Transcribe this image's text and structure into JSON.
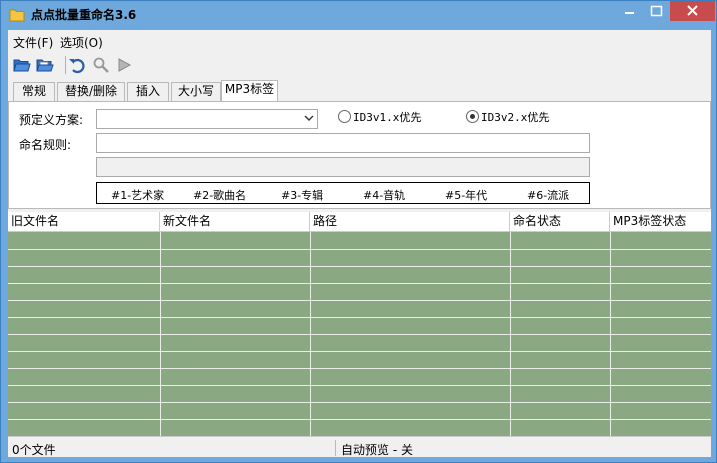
{
  "window": {
    "title": "点点批量重命名3.6",
    "icon": "folder-icon",
    "colors": {
      "frame": "#6ea8dc",
      "close": "#c94c4c",
      "grid": "#8aa982"
    }
  },
  "menu": {
    "file": "文件(F)",
    "options": "选项(O)"
  },
  "toolbar": {
    "icons": [
      "open-folder-icon",
      "open-files-icon",
      "undo-icon",
      "search-icon",
      "play-icon"
    ]
  },
  "tabs": [
    "常规",
    "替换/删除",
    "插入",
    "大小写",
    "MP3标签"
  ],
  "mp3": {
    "preset_label": "预定义方案:",
    "preset_value": "",
    "radio1": "ID3v1.x优先",
    "radio2": "ID3v2.x优先",
    "rule_label": "命名规则:",
    "rule_value": "",
    "preview_value": "",
    "tags": [
      "#1-艺术家",
      "#2-歌曲名",
      "#3-专辑",
      "#4-音轨",
      "#5-年代",
      "#6-流派"
    ]
  },
  "grid": {
    "columns": [
      "旧文件名",
      "新文件名",
      "路径",
      "命名状态",
      "MP3标签状态"
    ],
    "row_count": 12
  },
  "status": {
    "count": "0个文件",
    "preview": "自动预览 - 关"
  }
}
